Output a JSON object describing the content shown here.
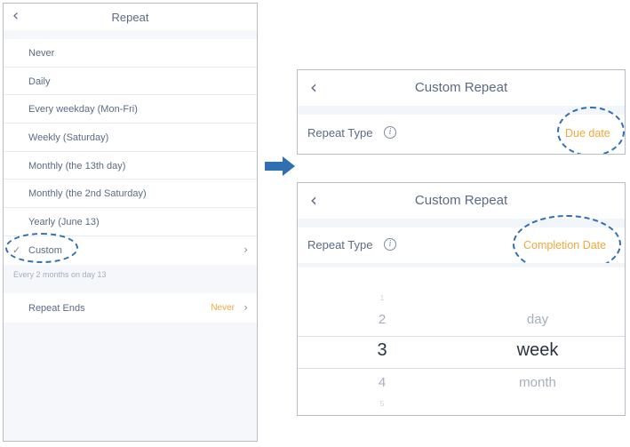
{
  "repeat_screen": {
    "back_icon": "chevron-left-icon",
    "title": "Repeat",
    "options": [
      {
        "label": "Never"
      },
      {
        "label": "Daily"
      },
      {
        "label": "Every weekday (Mon-Fri)"
      },
      {
        "label": "Weekly (Saturday)"
      },
      {
        "label": "Monthly (the 13th day)"
      },
      {
        "label": "Monthly (the 2nd Saturday)"
      },
      {
        "label": "Yearly (June 13)"
      },
      {
        "label": "Custom",
        "selected": true
      }
    ],
    "custom_note": "Every 2 months on day 13",
    "repeat_ends": {
      "label": "Repeat Ends",
      "value": "Never"
    }
  },
  "custom_repeat_top": {
    "title": "Custom Repeat",
    "repeat_type_label": "Repeat Type",
    "repeat_type_value": "Due date"
  },
  "custom_repeat_bottom": {
    "title": "Custom Repeat",
    "repeat_type_label": "Repeat Type",
    "repeat_type_value": "Completion Date",
    "picker": {
      "numbers": [
        "1",
        "2",
        "3",
        "4",
        "5"
      ],
      "selected_number": "3",
      "units": [
        "day",
        "week",
        "month"
      ],
      "selected_unit": "week"
    }
  },
  "colors": {
    "accent": "#f2a93b",
    "annotation": "#2f6fb2",
    "text": "#5b6b84"
  }
}
